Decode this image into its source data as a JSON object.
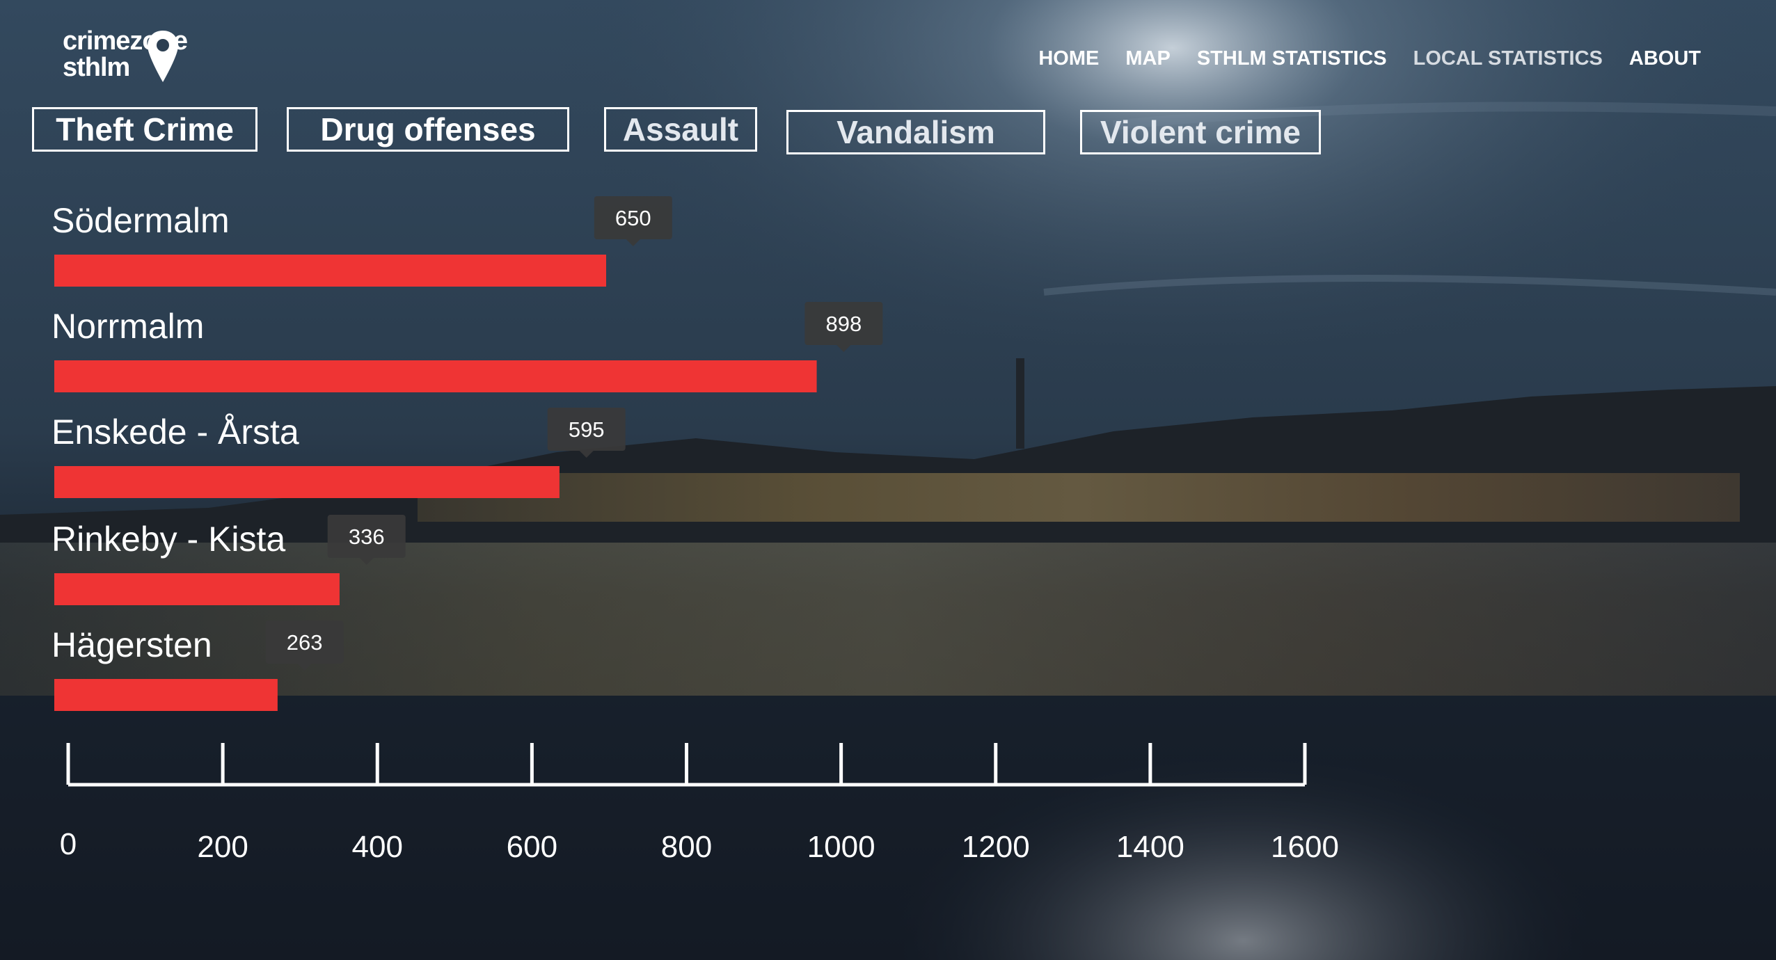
{
  "brand": {
    "line1": "crimezone",
    "line2": "sthlm"
  },
  "nav": {
    "items": [
      {
        "label": "HOME",
        "dim": false
      },
      {
        "label": "MAP",
        "dim": false
      },
      {
        "label": "STHLM STATISTICS",
        "dim": false
      },
      {
        "label": "LOCAL STATISTICS",
        "dim": true
      },
      {
        "label": "ABOUT",
        "dim": false
      }
    ]
  },
  "tabs": [
    {
      "label": "Theft Crime"
    },
    {
      "label": "Drug offenses"
    },
    {
      "label": "Assault"
    },
    {
      "label": "Vandalism"
    },
    {
      "label": "Violent crime"
    }
  ],
  "colors": {
    "bar": "#ef3434",
    "tooltip_bg": "#3a3a3a",
    "sky_top": "#2c3f52",
    "water": "#1b2430"
  },
  "chart_data": {
    "type": "bar",
    "orientation": "horizontal",
    "categories": [
      "Södermalm",
      "Norrmalm",
      "Enskede - Årsta",
      "Rinkeby - Kista",
      "Hägersten"
    ],
    "values": [
      650,
      898,
      595,
      336,
      263
    ],
    "value_labels": [
      "650",
      "898",
      "595",
      "336",
      "263"
    ],
    "xlim": [
      0,
      1600
    ],
    "xticks": [
      "0",
      "200",
      "400",
      "600",
      "800",
      "1000",
      "1200",
      "1400",
      "1600"
    ],
    "title": "",
    "xlabel": "",
    "ylabel": "",
    "grid": false,
    "legend": "none"
  }
}
